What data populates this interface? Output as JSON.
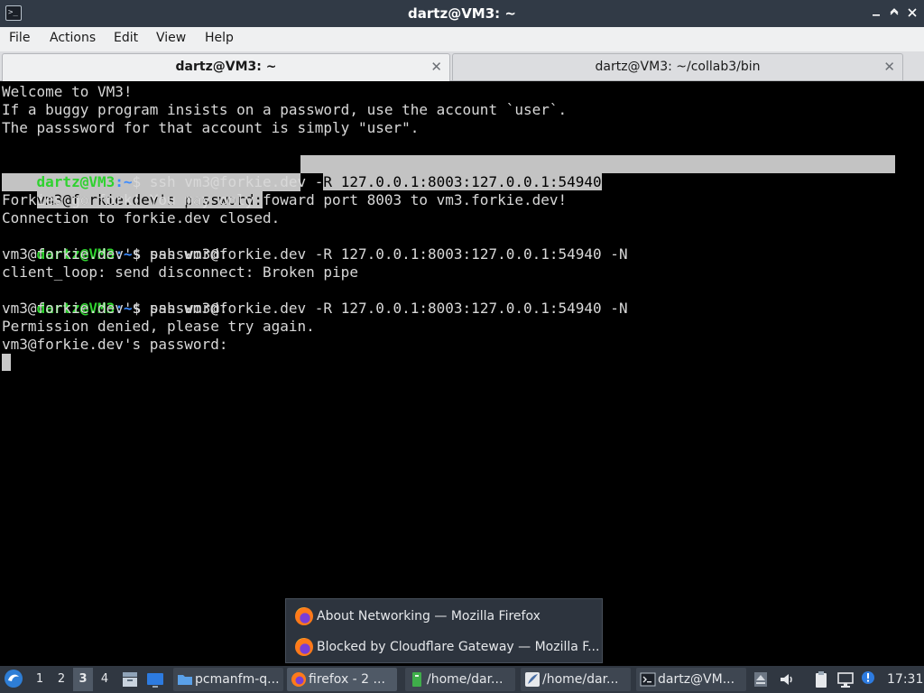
{
  "window": {
    "title": "dartz@VM3: ~",
    "app_icon": "terminal-icon",
    "controls": [
      "minimize-icon",
      "maximize-icon",
      "close-icon"
    ]
  },
  "menu": {
    "items": [
      "File",
      "Actions",
      "Edit",
      "View",
      "Help"
    ]
  },
  "tabs": [
    {
      "label": "dartz@VM3: ~",
      "active": true
    },
    {
      "label": "dartz@VM3: ~/collab3/bin",
      "active": false
    }
  ],
  "terminal": {
    "colors": {
      "background": "#000000",
      "text": "#d8d8d8",
      "prompt_user": "#2fd22f",
      "prompt_path": "#3b8bff",
      "selection": "#c3c3c3"
    },
    "lines": [
      "Welcome to VM3!",
      "If a buggy program insists on a password, use the account `user`.",
      "The passsword for that account is simply \"user\".",
      "",
      {
        "prompt_user": "dartz@VM3",
        "prompt_path": ":~",
        "cmd_pre": "$ ssh vm3@forkie.dev -",
        "cmd_sel": "R 127.0.0.1:8003:127.0.0.1:54940"
      },
      {
        "sel": "vm3@forkie.dev's password:"
      },
      "Forkies go fork! You may only foward port 8003 to vm3.forkie.dev!",
      "Connection to forkie.dev closed.",
      {
        "prompt_user": "dartz@VM3",
        "prompt_path": ":~",
        "cmd": "$ ssh vm3@forkie.dev -R 127.0.0.1:8003:127.0.0.1:54940 -N"
      },
      "vm3@forkie.dev's password:",
      "client_loop: send disconnect: Broken pipe",
      {
        "prompt_user": "dartz@VM3",
        "prompt_path": ":~",
        "cmd": "$ ssh vm3@forkie.dev -R 127.0.0.1:8003:127.0.0.1:54940 -N"
      },
      "vm3@forkie.dev's password:",
      "Permission denied, please try again.",
      "vm3@forkie.dev's password:"
    ]
  },
  "popup": {
    "items": [
      {
        "label": "About Networking — Mozilla Firefox",
        "icon": "firefox-icon"
      },
      {
        "label": "Blocked by Cloudflare Gateway — Mozilla F...",
        "icon": "firefox-icon"
      }
    ]
  },
  "taskbar": {
    "start_icon": "start-menu-icon",
    "workspaces": [
      "1",
      "2",
      "3",
      "4"
    ],
    "active_workspace": "3",
    "quicklaunch": [
      "file-manager-icon",
      "show-desktop-icon"
    ],
    "tasks": [
      {
        "label": "pcmanfm-q...",
        "icon": "folder-icon"
      },
      {
        "label": "firefox - 2 ...",
        "icon": "firefox-icon",
        "active": true
      },
      {
        "label": "/home/dar...",
        "icon": "text-editor-icon"
      },
      {
        "label": "/home/dar...",
        "icon": "feather-icon"
      },
      {
        "label": "dartz@VM...",
        "icon": "terminal-icon"
      }
    ],
    "tray": [
      "eject-icon",
      "volume-icon",
      "clipboard-icon",
      "network-icon",
      "update-icon"
    ],
    "clock": "17:31"
  }
}
